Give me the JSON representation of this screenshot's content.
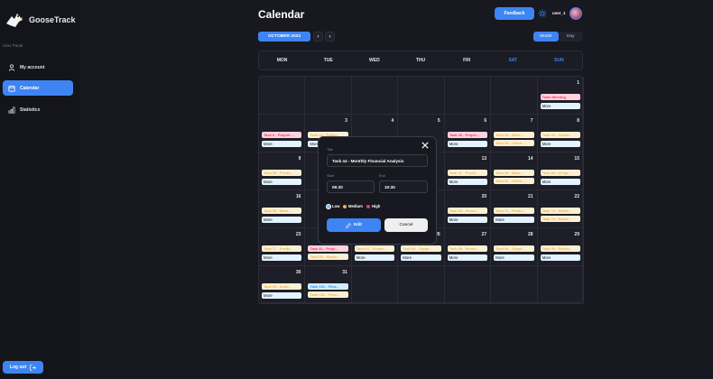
{
  "app": {
    "name": "GooseTrack"
  },
  "sidebar": {
    "panel_label": "User Panel",
    "items": [
      {
        "label": "My account",
        "icon": "user-icon"
      },
      {
        "label": "Calendar",
        "icon": "calendar-icon"
      },
      {
        "label": "Statistics",
        "icon": "chart-icon"
      }
    ],
    "logout_label": "Log out"
  },
  "header": {
    "title": "Calendar",
    "feedback_label": "Feedback",
    "user_name": "user_1"
  },
  "toolbar": {
    "month_label": "OCTOBER 2023",
    "prev_icon": "chevron-left-icon",
    "next_icon": "chevron-right-icon",
    "view_month": "Month",
    "view_day": "Day"
  },
  "weekdays": [
    "MON",
    "TUE",
    "WED",
    "THU",
    "FRI",
    "SAT",
    "SUN"
  ],
  "calendar": {
    "cells": [
      {
        "row": 0,
        "col": 6,
        "day": "1",
        "tasks": [
          {
            "text": "Team Meeting",
            "priority": "high"
          }
        ],
        "more": true
      },
      {
        "row": 1,
        "col": 0,
        "day": "",
        "tasks": [
          {
            "text": "Task 6 - Project ...",
            "priority": "high"
          }
        ],
        "more": true
      },
      {
        "row": 1,
        "col": 1,
        "day": "3",
        "tasks": [
          {
            "text": "Task 12 - Produ...",
            "priority": "medium"
          }
        ],
        "more": true
      },
      {
        "row": 1,
        "col": 2,
        "day": "4",
        "tasks": [],
        "more": false
      },
      {
        "row": 1,
        "col": 3,
        "day": "5",
        "tasks": [],
        "more": false
      },
      {
        "row": 1,
        "col": 4,
        "day": "6",
        "tasks": [
          {
            "text": "Task 26 - Projec...",
            "priority": "high"
          }
        ],
        "more": true
      },
      {
        "row": 1,
        "col": 5,
        "day": "7",
        "tasks": [
          {
            "text": "Task 29 - Mark...",
            "priority": "medium"
          },
          {
            "text": "Task 30 - Client ...",
            "priority": "medium"
          }
        ],
        "more": false
      },
      {
        "row": 1,
        "col": 6,
        "day": "8",
        "tasks": [
          {
            "text": "Task 32 - Produ...",
            "priority": "medium"
          }
        ],
        "more": true
      },
      {
        "row": 2,
        "col": 0,
        "day": "9",
        "tasks": [
          {
            "text": "Task 35 - Produ...",
            "priority": "medium"
          }
        ],
        "more": true
      },
      {
        "row": 2,
        "col": 4,
        "day": "13",
        "tasks": [
          {
            "text": "Task 47 - Produ...",
            "priority": "medium"
          }
        ],
        "more": true
      },
      {
        "row": 2,
        "col": 5,
        "day": "14",
        "tasks": [
          {
            "text": "Task 49 - Mark...",
            "priority": "medium"
          },
          {
            "text": "Task 51 - Client ...",
            "priority": "medium"
          }
        ],
        "more": false
      },
      {
        "row": 2,
        "col": 6,
        "day": "15",
        "tasks": [
          {
            "text": "Task 53 - UI Up...",
            "priority": "medium"
          }
        ],
        "more": true
      },
      {
        "row": 3,
        "col": 0,
        "day": "16",
        "tasks": [
          {
            "text": "Task 55 - Mark...",
            "priority": "medium"
          }
        ],
        "more": true
      },
      {
        "row": 3,
        "col": 4,
        "day": "20",
        "tasks": [
          {
            "text": "Task 66 - Resea...",
            "priority": "medium"
          }
        ],
        "more": true
      },
      {
        "row": 3,
        "col": 5,
        "day": "21",
        "tasks": [
          {
            "text": "Task 71 - Produ...",
            "priority": "medium"
          }
        ],
        "more": true
      },
      {
        "row": 3,
        "col": 6,
        "day": "22",
        "tasks": [
          {
            "text": "Task 73 - Marke...",
            "priority": "medium"
          },
          {
            "text": "Task 76 - Marke...",
            "priority": "medium"
          }
        ],
        "more": false
      },
      {
        "row": 4,
        "col": 0,
        "day": "23",
        "tasks": [
          {
            "text": "Task 77 - Produ...",
            "priority": "medium"
          }
        ],
        "more": true
      },
      {
        "row": 4,
        "col": 1,
        "day": "24",
        "tasks": [
          {
            "text": "Task 81 - Proje...",
            "priority": "high"
          },
          {
            "text": "Task 85 - Marke...",
            "priority": "medium"
          }
        ],
        "more": false
      },
      {
        "row": 4,
        "col": 2,
        "day": "25",
        "tasks": [
          {
            "text": "Task 61 - Financ...",
            "priority": "medium"
          }
        ],
        "more": true
      },
      {
        "row": 4,
        "col": 3,
        "day": "26",
        "tasks": [
          {
            "text": "Task 86 - Suppl...",
            "priority": "medium"
          }
        ],
        "more": true
      },
      {
        "row": 4,
        "col": 4,
        "day": "27",
        "tasks": [
          {
            "text": "Task 88 - Resea...",
            "priority": "medium"
          }
        ],
        "more": true
      },
      {
        "row": 4,
        "col": 5,
        "day": "28",
        "tasks": [
          {
            "text": "Task 90 - Suppl...",
            "priority": "medium"
          }
        ],
        "more": true
      },
      {
        "row": 4,
        "col": 6,
        "day": "29",
        "tasks": [
          {
            "text": "Task 95 - Financ...",
            "priority": "medium"
          }
        ],
        "more": true
      },
      {
        "row": 5,
        "col": 0,
        "day": "30",
        "tasks": [
          {
            "text": "Task 99 - Acad...",
            "priority": "medium"
          }
        ],
        "more": true
      },
      {
        "row": 5,
        "col": 1,
        "day": "31",
        "tasks": [
          {
            "text": "Task 101 - Fina...",
            "priority": "low"
          },
          {
            "text": "Task 102 - Prod...",
            "priority": "medium"
          }
        ],
        "more": false
      }
    ]
  },
  "modal": {
    "title_label": "Title",
    "title_value": "Task 44 - Monthly Financial Analysis",
    "start_label": "Start",
    "start_value": "09:30",
    "end_label": "End",
    "end_value": "10:30",
    "priorities": [
      {
        "label": "Low",
        "color": "#72c2f8"
      },
      {
        "label": "Medium",
        "color": "#f3b249"
      },
      {
        "label": "High",
        "color": "#ea3d65"
      }
    ],
    "edit_label": "Edit",
    "cancel_label": "Cancel"
  },
  "more_label": "More",
  "colors": {
    "accent": "#3e85f3",
    "bg": "#171820",
    "sidebar": "#13151a",
    "high": "#ea3d65",
    "medium": "#f3b249",
    "low": "#3e85f3"
  }
}
